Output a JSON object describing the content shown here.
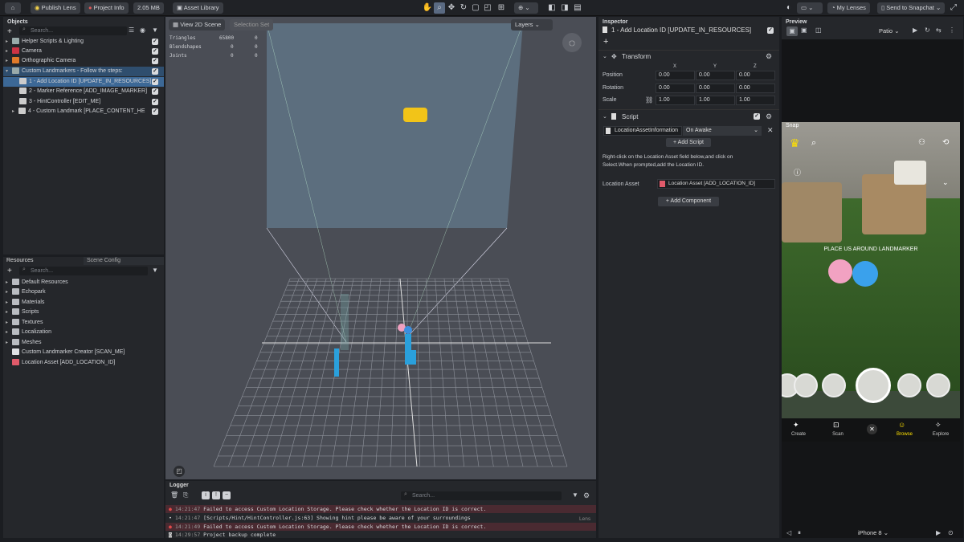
{
  "topbar": {
    "publish": "Publish Lens",
    "project_info": "Project Info",
    "size": "2.05 MB",
    "asset_library": "Asset Library",
    "my_lenses": "My Lenses",
    "send": "Send to Snapchat"
  },
  "objects": {
    "title": "Objects",
    "search_placeholder": "Search...",
    "items": [
      "Helper Scripts & Lighting",
      "Camera",
      "Orthographic Camera",
      "Custom Landmarkers - Follow the steps:",
      "1 - Add Location ID [UPDATE_IN_RESOURCES]",
      "2 - Marker Reference [ADD_IMAGE_MARKER]",
      "3 - HintController [EDIT_ME]",
      "4 - Custom Landmark [PLACE_CONTENT_HE"
    ]
  },
  "resources": {
    "tab1": "Resources",
    "tab2": "Scene Config",
    "search_placeholder": "Search...",
    "items": [
      "Default Resources",
      "Echopark",
      "Materials",
      "Scripts",
      "Textures",
      "Localization",
      "Meshes",
      "Custom Landmarker Creator [SCAN_ME]",
      "Location Asset [ADD_LOCATION_ID]"
    ]
  },
  "scene": {
    "view_btn": "View 2D Scene",
    "selection_btn": "Selection Set",
    "layers": "Layers",
    "stats": [
      [
        "Triangles",
        "65800",
        "0"
      ],
      [
        "Blendshapes",
        "0",
        "0"
      ],
      [
        "Joints",
        "0",
        "0"
      ]
    ]
  },
  "logger": {
    "title": "Logger",
    "search_placeholder": "Search...",
    "lens": "Lens",
    "lines": [
      {
        "time": "14:21:47",
        "text": "Failed to access Custom Location Storage. Please check whether the Location ID is correct.",
        "type": "error"
      },
      {
        "time": "14:21:47",
        "text": "[Scripts/Hint/HintController.js:63] Showing hint please be aware of your surroundings",
        "type": "info"
      },
      {
        "time": "14:21:49",
        "text": "Failed to access Custom Location Storage. Please check whether the Location ID is correct.",
        "type": "error"
      },
      {
        "time": "14:29:57",
        "text": "Project backup complete",
        "type": "info"
      }
    ]
  },
  "inspector": {
    "title": "Inspector",
    "object_name": "1 - Add Location ID [UPDATE_IN_RESOURCES]",
    "transform": "Transform",
    "axes": [
      "X",
      "Y",
      "Z"
    ],
    "position_label": "Position",
    "rotation_label": "Rotation",
    "scale_label": "Scale",
    "position": [
      "0.00",
      "0.00",
      "0.00"
    ],
    "rotation": [
      "0.00",
      "0.00",
      "0.00"
    ],
    "scale": [
      "1.00",
      "1.00",
      "1.00"
    ],
    "script": "Script",
    "script_file": "LocationAssetInformation",
    "trigger": "On Awake",
    "add_script": "Add Script",
    "help": "Right-click on the Location Asset field below,and click on Select.When prompted,add the Location ID.",
    "location_asset_label": "Location Asset",
    "location_asset_value": "Location Asset [ADD_LOCATION_ID]",
    "add_component": "Add Component"
  },
  "preview": {
    "title": "Preview",
    "scene": "Patio",
    "carrier": "Snap",
    "ar_text": "PLACE US AROUND LANDMARKER",
    "nav": [
      "Create",
      "Scan",
      "Browse",
      "Explore"
    ],
    "device": "iPhone 8"
  }
}
